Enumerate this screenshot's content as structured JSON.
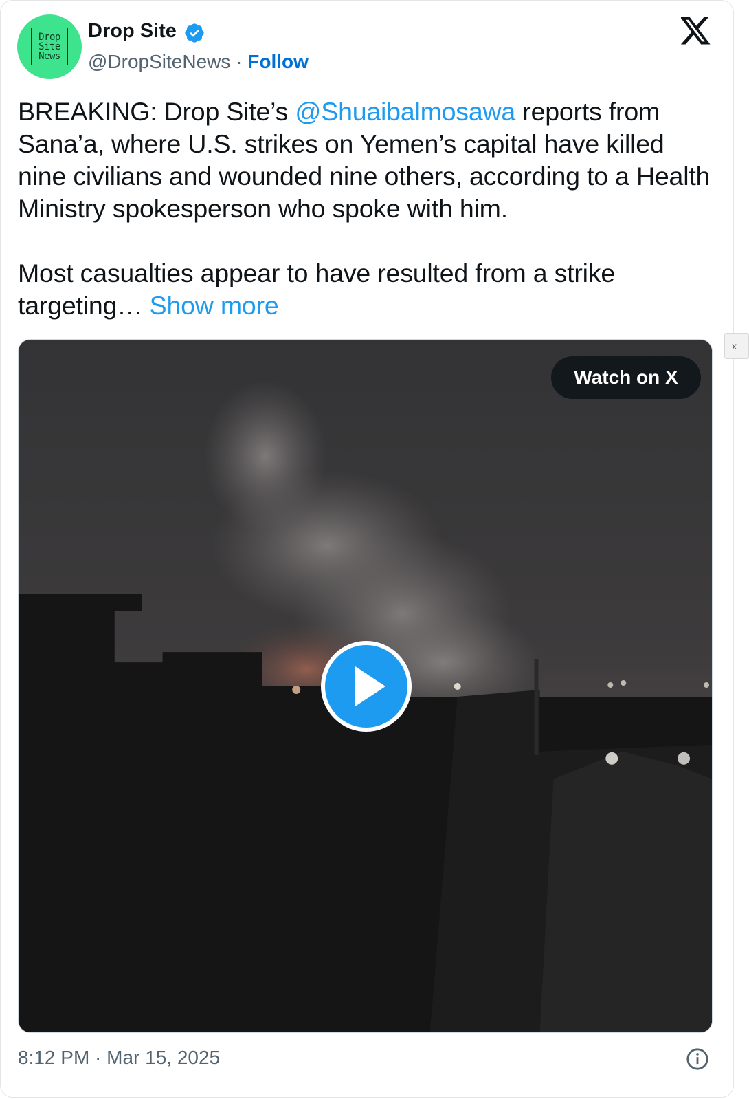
{
  "author": {
    "name": "Drop Site",
    "handle": "@DropSiteNews",
    "separator": " · ",
    "follow_label": "Follow",
    "avatar_lines": [
      "Drop",
      "Site",
      "News"
    ],
    "avatar_color": "#3ee38e",
    "verified_icon": "verified-badge-icon"
  },
  "tweet": {
    "p1_prefix": "BREAKING: Drop Site’s ",
    "p1_mention": "@Shuaibalmosawa",
    "p1_suffix": " reports from Sana’a, where U.S. strikes on Yemen’s capital have killed nine civilians and wounded nine others, according to a Health Ministry spokesperson who spoke with him.",
    "p2": "Most casualties appear to have resulted from a strike targeting… ",
    "show_more": "Show more"
  },
  "media": {
    "watch_label": "Watch on X",
    "play_icon": "play-icon"
  },
  "footer": {
    "timestamp": "8:12 PM · Mar 15, 2025",
    "info_icon": "info-icon"
  },
  "colors": {
    "link": "#1d9bf0",
    "follow": "#006fd6",
    "secondary_text": "#536471"
  },
  "side_tab": {
    "label": "x"
  }
}
